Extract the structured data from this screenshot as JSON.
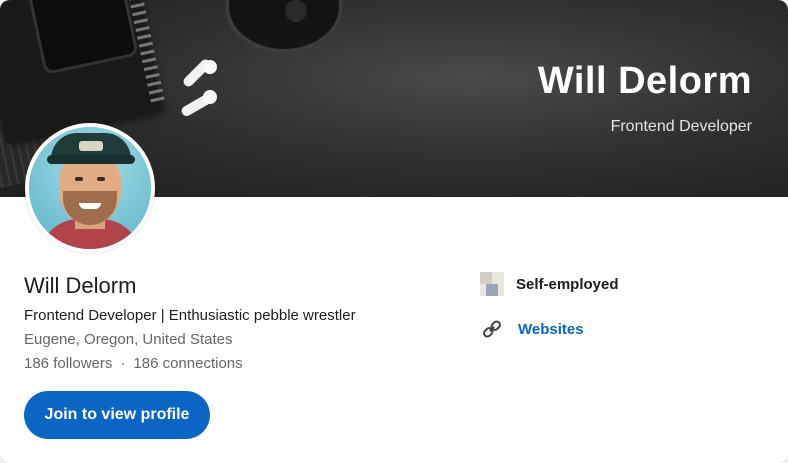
{
  "banner": {
    "name": "Will Delorm",
    "role": "Frontend Developer"
  },
  "profile": {
    "name": "Will Delorm",
    "headline": "Frontend Developer | Enthusiastic pebble wrestler",
    "location": "Eugene, Oregon, United States",
    "followers": "186 followers",
    "separator": "·",
    "connections": "186 connections"
  },
  "actions": {
    "join_label": "Join to view profile"
  },
  "side": {
    "company": "Self-employed",
    "websites": "Websites"
  },
  "colors": {
    "primary": "#0a66c2",
    "banner": "#2c2c2c",
    "text": "#1d1d1d",
    "muted": "#666666"
  },
  "icons": [
    "company-logo-icon",
    "link-icon"
  ]
}
